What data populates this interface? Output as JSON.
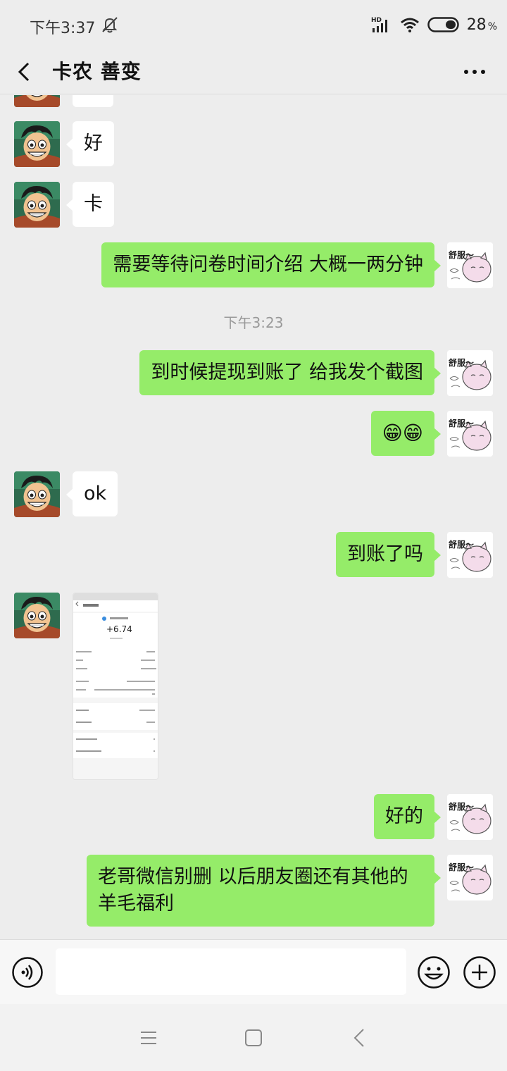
{
  "status": {
    "time": "下午3:37",
    "network": "HD",
    "battery_text": "28",
    "battery_unit": "%"
  },
  "header": {
    "title": "卡农 善变"
  },
  "messages": [
    {
      "side": "left",
      "type": "text",
      "text": "好"
    },
    {
      "side": "left",
      "type": "text",
      "text": "卡"
    },
    {
      "side": "right",
      "type": "text",
      "text": "需要等待问卷时间介绍 大概一两分钟"
    },
    {
      "type": "time",
      "text": "下午3:23"
    },
    {
      "side": "right",
      "type": "text",
      "text": "到时候提现到账了 给我发个截图"
    },
    {
      "side": "right",
      "type": "emoji",
      "text": "😁😁"
    },
    {
      "side": "left",
      "type": "text",
      "text": "ok"
    },
    {
      "side": "right",
      "type": "text",
      "text": "到账了吗"
    },
    {
      "side": "left",
      "type": "image",
      "amount": "+6.74"
    },
    {
      "side": "right",
      "type": "text",
      "text": "好的"
    },
    {
      "side": "right",
      "type": "text",
      "text": "老哥微信别删 以后朋友圈还有其他的羊毛福利"
    }
  ],
  "sticker_text": "舒服～",
  "input": {
    "value": "",
    "placeholder": ""
  },
  "colors": {
    "outgoing_bubble": "#95ec69",
    "incoming_bubble": "#ffffff",
    "background": "#ededed"
  },
  "icons": {
    "back": "chevron-left-icon",
    "more": "more-dots-icon",
    "voice": "voice-icon",
    "emoji": "emoji-icon",
    "plus": "plus-icon",
    "nav_menu": "menu-icon",
    "nav_home": "home-square-icon",
    "nav_back": "nav-back-icon"
  }
}
